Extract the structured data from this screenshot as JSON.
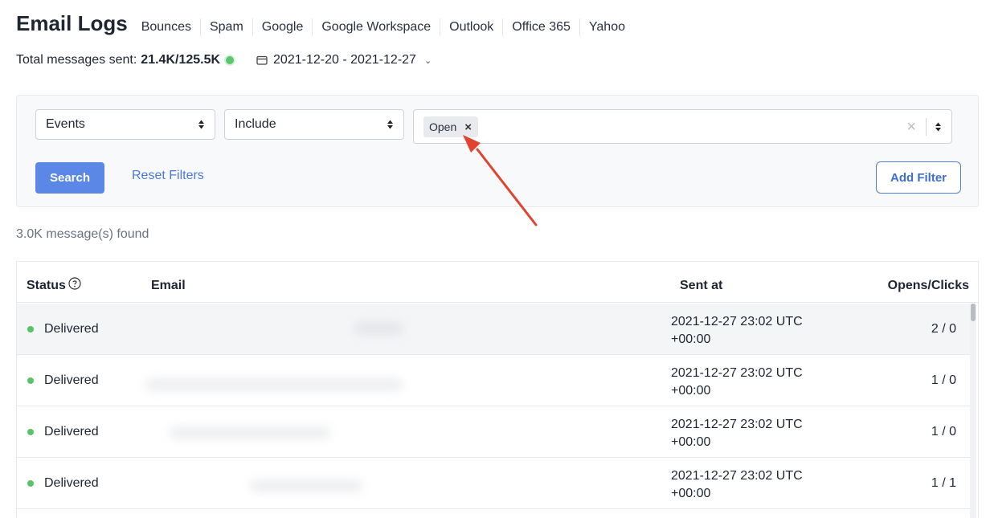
{
  "header": {
    "title": "Email Logs",
    "nav": [
      "Bounces",
      "Spam",
      "Google",
      "Google Workspace",
      "Outlook",
      "Office 365",
      "Yahoo"
    ]
  },
  "summary": {
    "label": "Total messages sent:",
    "value": "21.4K/125.5K",
    "date_range": "2021-12-20 - 2021-12-27"
  },
  "filters": {
    "field": "Events",
    "operator": "Include",
    "tags": [
      "Open"
    ],
    "search_label": "Search",
    "reset_label": "Reset Filters",
    "add_label": "Add Filter"
  },
  "results": {
    "found_text": "3.0K message(s) found"
  },
  "table": {
    "columns": [
      "Status",
      "Email",
      "Sent at",
      "Opens/Clicks"
    ],
    "rows": [
      {
        "status": "Delivered",
        "sent_at_line1": "2021-12-27 23:02 UTC",
        "sent_at_line2": "+00:00",
        "opens_clicks": "2 / 0"
      },
      {
        "status": "Delivered",
        "sent_at_line1": "2021-12-27 23:02 UTC",
        "sent_at_line2": "+00:00",
        "opens_clicks": "1 / 0"
      },
      {
        "status": "Delivered",
        "sent_at_line1": "2021-12-27 23:02 UTC",
        "sent_at_line2": "+00:00",
        "opens_clicks": "1 / 0"
      },
      {
        "status": "Delivered",
        "sent_at_line1": "2021-12-27 23:02 UTC",
        "sent_at_line2": "+00:00",
        "opens_clicks": "1 / 1"
      }
    ]
  },
  "colors": {
    "primary": "#5b87e6",
    "link": "#4a7ad8",
    "delivered": "#54c464",
    "annotation_arrow": "#e0442f"
  },
  "icons": {
    "date": "calendar-icon",
    "help": "question-circle-icon",
    "sort": "sort-arrows-icon",
    "clear": "clear-x-icon",
    "remove_tag": "close-icon"
  }
}
